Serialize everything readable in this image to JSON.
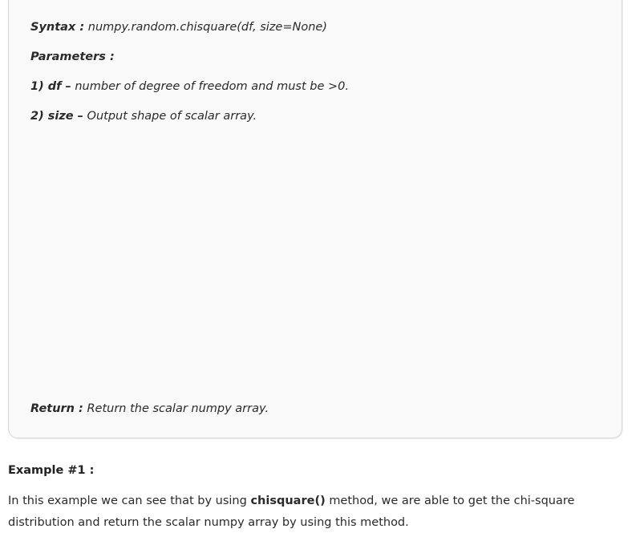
{
  "syntax_box": {
    "syntax_label": "Syntax :",
    "syntax_value": "numpy.random.chisquare(df, size=None)",
    "parameters_label": "Parameters :",
    "param1_label": "1) df –",
    "param1_desc": "number of degree of freedom and must be >0.",
    "param2_label": "2) size –",
    "param2_desc": "Output shape of scalar array.",
    "return_label": "Return :",
    "return_desc": "Return the scalar numpy array."
  },
  "example": {
    "heading": "Example #1 :",
    "text_before": "In this example we can see that by using",
    "method_name": "chisquare()",
    "text_after": "method, we are able to get the chi-square distribution and return the scalar numpy array by using this method."
  }
}
